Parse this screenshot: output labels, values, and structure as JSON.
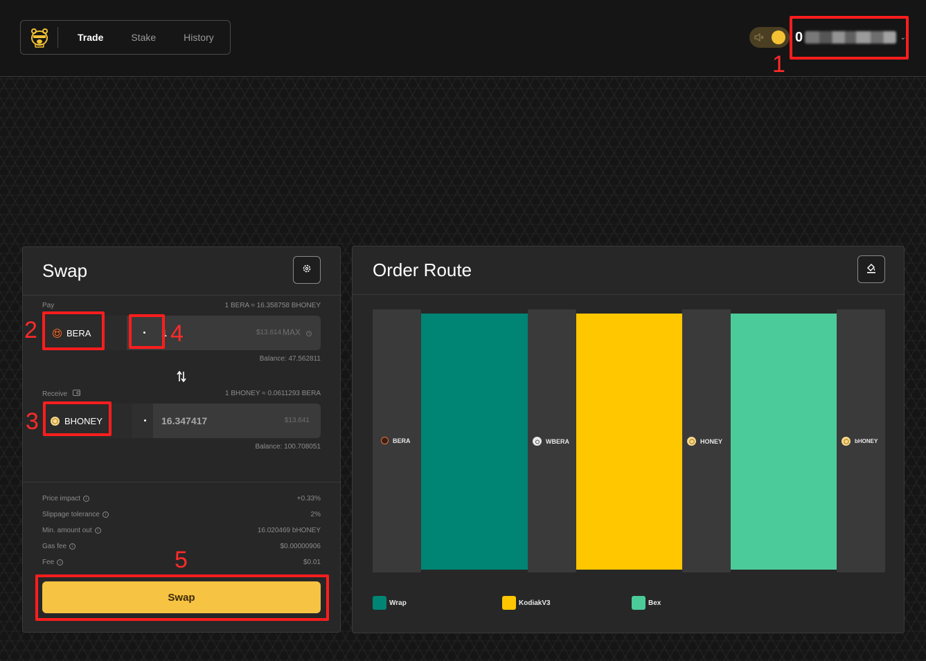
{
  "nav": {
    "items": [
      "Trade",
      "Stake",
      "History"
    ],
    "active": "Trade"
  },
  "wallet": {
    "address_prefix": "0",
    "chevron": "chevron-down-icon"
  },
  "swap": {
    "title": "Swap",
    "pay": {
      "label": "Pay",
      "rate": "1 BERA ≈ 16.358758 BHONEY",
      "token": "BERA",
      "amount": "1",
      "usd": "$13.614",
      "max": "MAX",
      "balance": "Balance: 47.562811"
    },
    "receive": {
      "label": "Receive",
      "rate": "1 BHONEY ≈ 0.0611293 BERA",
      "token": "BHONEY",
      "amount": "16.347417",
      "usd": "$13.641",
      "balance": "Balance: 100.708051"
    },
    "details": [
      {
        "label": "Price impact",
        "value": "+0.33%"
      },
      {
        "label": "Slippage tolerance",
        "value": "2%"
      },
      {
        "label": "Min. amount out",
        "value": "16.020469 bHONEY"
      },
      {
        "label": "Gas fee",
        "value": "$0.00000906"
      },
      {
        "label": "Fee",
        "value": "$0.01"
      }
    ],
    "button": "Swap"
  },
  "route": {
    "title": "Order Route",
    "nodes": [
      "BERA",
      "WBERA",
      "HONEY",
      "bHONEY"
    ],
    "legend": [
      {
        "label": "Wrap",
        "color": "#008474"
      },
      {
        "label": "KodiakV3",
        "color": "#ffc700"
      },
      {
        "label": "Bex",
        "color": "#4ccb9a"
      }
    ]
  },
  "annotations": [
    "1",
    "2",
    "3",
    "4",
    "5"
  ],
  "colors": {
    "accent": "#f6c342",
    "annotation": "#ff1d1d"
  }
}
